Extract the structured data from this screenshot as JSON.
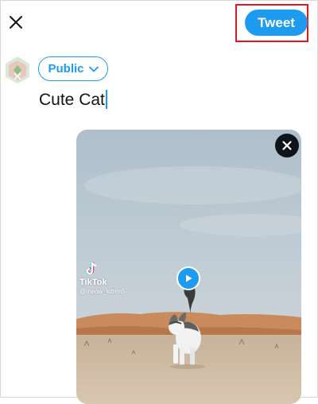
{
  "header": {
    "close_icon": "close-icon",
    "tweet_label": "Tweet"
  },
  "composer": {
    "audience_label": "Public",
    "audience_icon": "chevron-down-icon",
    "text": "Cute Cat"
  },
  "media": {
    "remove_icon": "close-icon",
    "play_icon": "play-icon",
    "watermark_brand": "TikTok",
    "watermark_handle": "@meow_kitten5"
  },
  "colors": {
    "accent": "#1d9bf0",
    "highlight": "#e0151f",
    "text": "#0f1419"
  }
}
